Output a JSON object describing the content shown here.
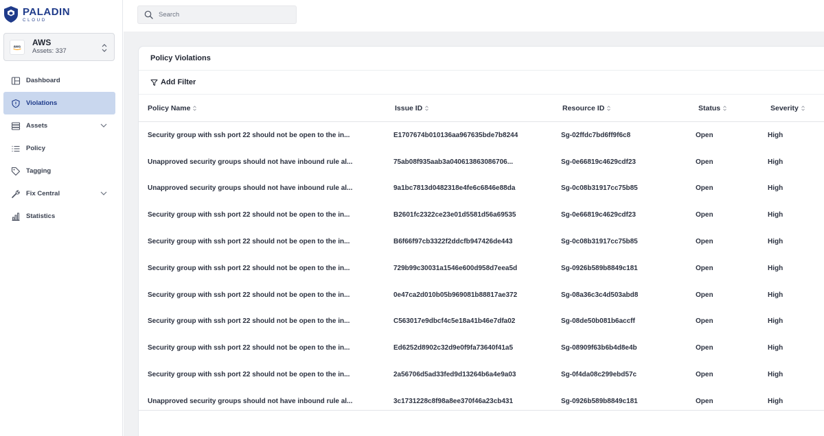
{
  "brand": {
    "name": "PALADIN",
    "sub": "CLOUD",
    "primary_color": "#1f3b8a"
  },
  "account": {
    "name": "AWS",
    "assets": "Assets: 337",
    "icon": "aws-icon"
  },
  "nav": [
    {
      "label": "Dashboard",
      "icon": "dashboard-icon",
      "active": false,
      "expandable": false
    },
    {
      "label": "Violations",
      "icon": "shield-icon",
      "active": true,
      "expandable": false
    },
    {
      "label": "Assets",
      "icon": "stack-icon",
      "active": false,
      "expandable": true
    },
    {
      "label": "Policy",
      "icon": "list-icon",
      "active": false,
      "expandable": false
    },
    {
      "label": "Tagging",
      "icon": "tag-icon",
      "active": false,
      "expandable": false
    },
    {
      "label": "Fix Central",
      "icon": "wrench-icon",
      "active": false,
      "expandable": true
    },
    {
      "label": "Statistics",
      "icon": "bar-chart-icon",
      "active": false,
      "expandable": false
    }
  ],
  "search": {
    "placeholder": "Search",
    "value": ""
  },
  "card": {
    "title": "Policy Violations",
    "filter_label": "Add Filter"
  },
  "table": {
    "columns": [
      "Policy Name",
      "Issue ID",
      "Resource ID",
      "Status",
      "Severity"
    ],
    "rows": [
      [
        "Security group with ssh port 22 should not be open to the in...",
        "E1707674b010136aa967635bde7b8244",
        "Sg-02ffdc7bd6ff9f6c8",
        "Open",
        "High"
      ],
      [
        "Unapproved security groups should not have inbound rule al...",
        "75ab08f935aab3a040613863086706...",
        "Sg-0e66819c4629cdf23",
        "Open",
        "High"
      ],
      [
        "Unapproved security groups should not have inbound rule al...",
        "9a1bc7813d0482318e4fe6c6846e88da",
        "Sg-0c08b31917cc75b85",
        "Open",
        "High"
      ],
      [
        "Security group with ssh port 22 should not be open to the in...",
        "B2601fc2322ce23e01d5581d56a69535",
        "Sg-0e66819c4629cdf23",
        "Open",
        "High"
      ],
      [
        "Security group with ssh port 22 should not be open to the in...",
        "B6f66f97cb3322f2ddcfb947426de443",
        "Sg-0c08b31917cc75b85",
        "Open",
        "High"
      ],
      [
        "Security group with ssh port 22 should not be open to the in...",
        "729b99c30031a1546e600d958d7eea5d",
        "Sg-0926b589b8849c181",
        "Open",
        "High"
      ],
      [
        "Security group with ssh port 22 should not be open to the in...",
        "0e47ca2d010b05b969081b88817ae372",
        "Sg-08a36c3c4d503abd8",
        "Open",
        "High"
      ],
      [
        "Security group with ssh port 22 should not be open to the in...",
        "C563017e9dbcf4c5e18a41b46e7dfa02",
        "Sg-08de50b081b6accff",
        "Open",
        "High"
      ],
      [
        "Security group with ssh port 22 should not be open to the in...",
        "Ed6252d8902c32d9e0f9fa73640f41a5",
        "Sg-08909f63b6b4d8e4b",
        "Open",
        "High"
      ],
      [
        "Security group with ssh port 22 should not be open to the in...",
        "2a56706d5ad33fed9d13264b6a4e9a03",
        "Sg-0f4da08c299ebd57c",
        "Open",
        "High"
      ],
      [
        "Unapproved security groups should not have inbound rule al...",
        "3c1731228c8f98a8ee370f46a23cb431",
        "Sg-0926b589b8849c181",
        "Open",
        "High"
      ]
    ]
  }
}
